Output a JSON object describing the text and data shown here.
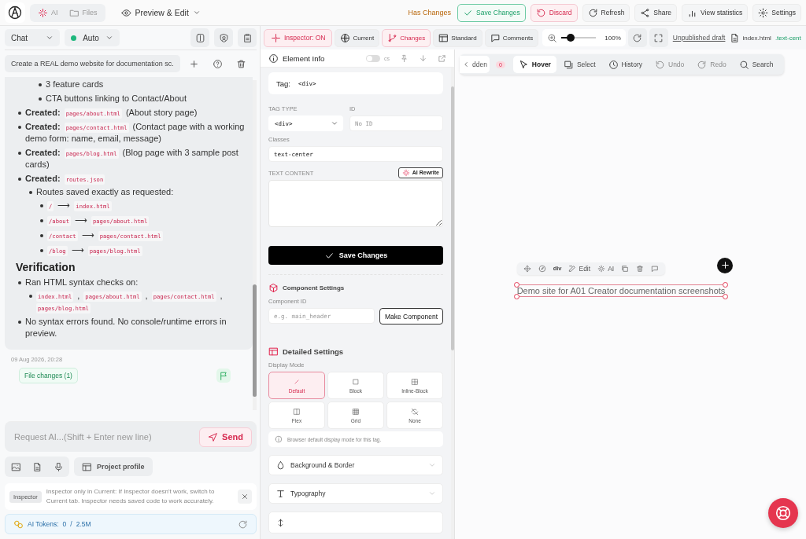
{
  "header": {
    "nav_tabs": [
      {
        "label": "AI",
        "selected": true
      },
      {
        "label": "Files",
        "selected": false
      }
    ],
    "mode": "Preview & Edit",
    "status": "Has Changes",
    "actions": [
      {
        "label": "Save Changes",
        "kind": "save"
      },
      {
        "label": "Discard",
        "kind": "discard"
      },
      {
        "label": "Refresh",
        "kind": "refresh"
      },
      {
        "label": "Share",
        "kind": "share"
      },
      {
        "label": "View statistics",
        "kind": "stats"
      },
      {
        "label": "Settings",
        "kind": "settings"
      }
    ]
  },
  "chat": {
    "mode_select": "Chat",
    "model_select": "Auto",
    "title": "Create a REAL demo website for documentation sc.",
    "message": [
      {
        "kind": "sublist",
        "items": [
          {
            "parts": [
              {
                "kind": "text",
                "text": "3 feature cards"
              }
            ]
          },
          {
            "parts": [
              {
                "kind": "text",
                "text": "CTA buttons linking to Contact/About"
              }
            ]
          }
        ]
      },
      {
        "kind": "list",
        "items": [
          {
            "parts": [
              {
                "kind": "bold",
                "text": "Created:"
              },
              {
                "kind": "code",
                "text": "pages/about.html"
              },
              {
                "kind": "text",
                "text": "(About story page)"
              }
            ]
          },
          {
            "parts": [
              {
                "kind": "bold",
                "text": "Created:"
              },
              {
                "kind": "code",
                "text": "pages/contact.html"
              },
              {
                "kind": "text",
                "text": "(Contact page with a working demo form: name, email, message)"
              }
            ]
          },
          {
            "parts": [
              {
                "kind": "bold",
                "text": "Created:"
              },
              {
                "kind": "code",
                "text": "pages/blog.html"
              },
              {
                "kind": "text",
                "text": "(Blog page with 3 sample post cards)"
              }
            ]
          },
          {
            "parts": [
              {
                "kind": "bold",
                "text": "Created:"
              },
              {
                "kind": "code",
                "text": "routes.json"
              }
            ],
            "children": [
              {
                "parts": [
                  {
                    "kind": "text",
                    "text": "Routes saved exactly as requested:"
                  }
                ],
                "children": [
                  {
                    "parts": [
                      {
                        "kind": "code",
                        "text": "/"
                      },
                      {
                        "kind": "text",
                        "text": "⟶"
                      },
                      {
                        "kind": "code",
                        "text": "index.html"
                      }
                    ]
                  },
                  {
                    "parts": [
                      {
                        "kind": "code",
                        "text": "/about"
                      },
                      {
                        "kind": "text",
                        "text": "⟶"
                      },
                      {
                        "kind": "code",
                        "text": "pages/about.html"
                      }
                    ]
                  },
                  {
                    "parts": [
                      {
                        "kind": "code",
                        "text": "/contact"
                      },
                      {
                        "kind": "text",
                        "text": "⟶"
                      },
                      {
                        "kind": "code",
                        "text": "pages/contact.html"
                      }
                    ]
                  },
                  {
                    "parts": [
                      {
                        "kind": "code",
                        "text": "/blog"
                      },
                      {
                        "kind": "text",
                        "text": "⟶"
                      },
                      {
                        "kind": "code",
                        "text": "pages/blog.html"
                      }
                    ]
                  }
                ]
              }
            ]
          }
        ]
      },
      {
        "kind": "heading",
        "text": "Verification"
      },
      {
        "kind": "list",
        "items": [
          {
            "parts": [
              {
                "kind": "text",
                "text": "Ran HTML syntax checks on:"
              }
            ],
            "children": [
              {
                "parts": [
                  {
                    "kind": "code",
                    "text": "index.html"
                  },
                  {
                    "kind": "text",
                    "text": ","
                  },
                  {
                    "kind": "code",
                    "text": "pages/about.html"
                  },
                  {
                    "kind": "text",
                    "text": ","
                  },
                  {
                    "kind": "code",
                    "text": "pages/contact.html"
                  },
                  {
                    "kind": "text",
                    "text": ","
                  },
                  {
                    "kind": "code",
                    "text": "pages/blog.html"
                  }
                ]
              }
            ]
          },
          {
            "parts": [
              {
                "kind": "text",
                "text": "No syntax errors found. No console/runtime errors in preview."
              }
            ]
          }
        ]
      }
    ],
    "timestamp": "09 Aug 2026, 20:28",
    "file_changes": "File changes (1)",
    "input": {
      "placeholder": "Request AI...(Shift + Enter new line)"
    },
    "send": "Send",
    "project_profile": "Project profile",
    "notice": {
      "tag": "Inspector",
      "text": "Inspector only in Current: If Inspector doesn't work, switch to Current tab. Inspector needs saved code to work accurately."
    },
    "tokens": {
      "label": "AI Tokens:",
      "used": "0",
      "separator": "/",
      "limit": "2.5M"
    }
  },
  "toolbar": {
    "inspector": {
      "label": "Inspector: ON",
      "on": true
    },
    "view_tabs": [
      {
        "label": "Current",
        "kind": "globe",
        "selected": false
      },
      {
        "label": "Changes",
        "kind": "branch",
        "selected": true
      },
      {
        "label": "Standard",
        "kind": "layout",
        "selected": false
      },
      {
        "label": "Comments",
        "kind": "comment",
        "selected": false
      }
    ],
    "zoom": {
      "level": 0.27,
      "reading": "100%"
    },
    "draft_link": "Unpublished draft",
    "file": "index.html",
    "selector": ".text-cent"
  },
  "element_info": {
    "title": "Element Info",
    "css_toggle": {
      "label": "cs",
      "on": false
    },
    "tag": {
      "label": "Tag:",
      "value": "<div>"
    },
    "tag_type": {
      "label": "TAG TYPE",
      "value": "<div>"
    },
    "id": {
      "label": "ID",
      "placeholder": "No ID"
    },
    "classes": {
      "label": "Classes",
      "value": "text-center"
    },
    "text_content": {
      "label": "TEXT CONTENT",
      "rewrite": "AI Rewrite"
    },
    "save": "Save Changes",
    "component": {
      "title": "Component Settings",
      "label": "Component ID",
      "placeholder": "e.g. main_header",
      "button": "Make Component"
    },
    "detailed": {
      "title": "Detailed Settings",
      "label": "Display Mode",
      "modes": [
        {
          "label": "Default",
          "kind": "default",
          "selected": true
        },
        {
          "label": "Block",
          "kind": "block",
          "selected": false
        },
        {
          "label": "Inline-Block",
          "kind": "inline",
          "selected": false
        },
        {
          "label": "Flex",
          "kind": "flex",
          "selected": false
        },
        {
          "label": "Grid",
          "kind": "grid",
          "selected": false
        },
        {
          "label": "None",
          "kind": "none",
          "selected": false
        }
      ],
      "hint": "Browser default display mode for this tag."
    },
    "sections": [
      {
        "label": "Background & Border",
        "kind": "drop"
      },
      {
        "label": "Typography",
        "kind": "type"
      }
    ]
  },
  "preview": {
    "hidden_label": "dden",
    "hidden_count": "0",
    "tools": [
      {
        "label": "Hover",
        "kind": "pointer",
        "selected": true,
        "disabled": false
      },
      {
        "label": "Select",
        "kind": "select",
        "selected": false,
        "disabled": false
      },
      {
        "label": "History",
        "kind": "clock",
        "selected": false,
        "disabled": false
      },
      {
        "label": "Undo",
        "kind": "undo",
        "selected": false,
        "disabled": true
      },
      {
        "label": "Redo",
        "kind": "redo",
        "selected": false,
        "disabled": true
      },
      {
        "label": "Search",
        "kind": "search",
        "selected": false,
        "disabled": false
      }
    ],
    "element": {
      "tag": "div",
      "edit": "Edit",
      "ai": "AI",
      "text": "Demo site for A01 Creator documentation screenshots"
    }
  }
}
